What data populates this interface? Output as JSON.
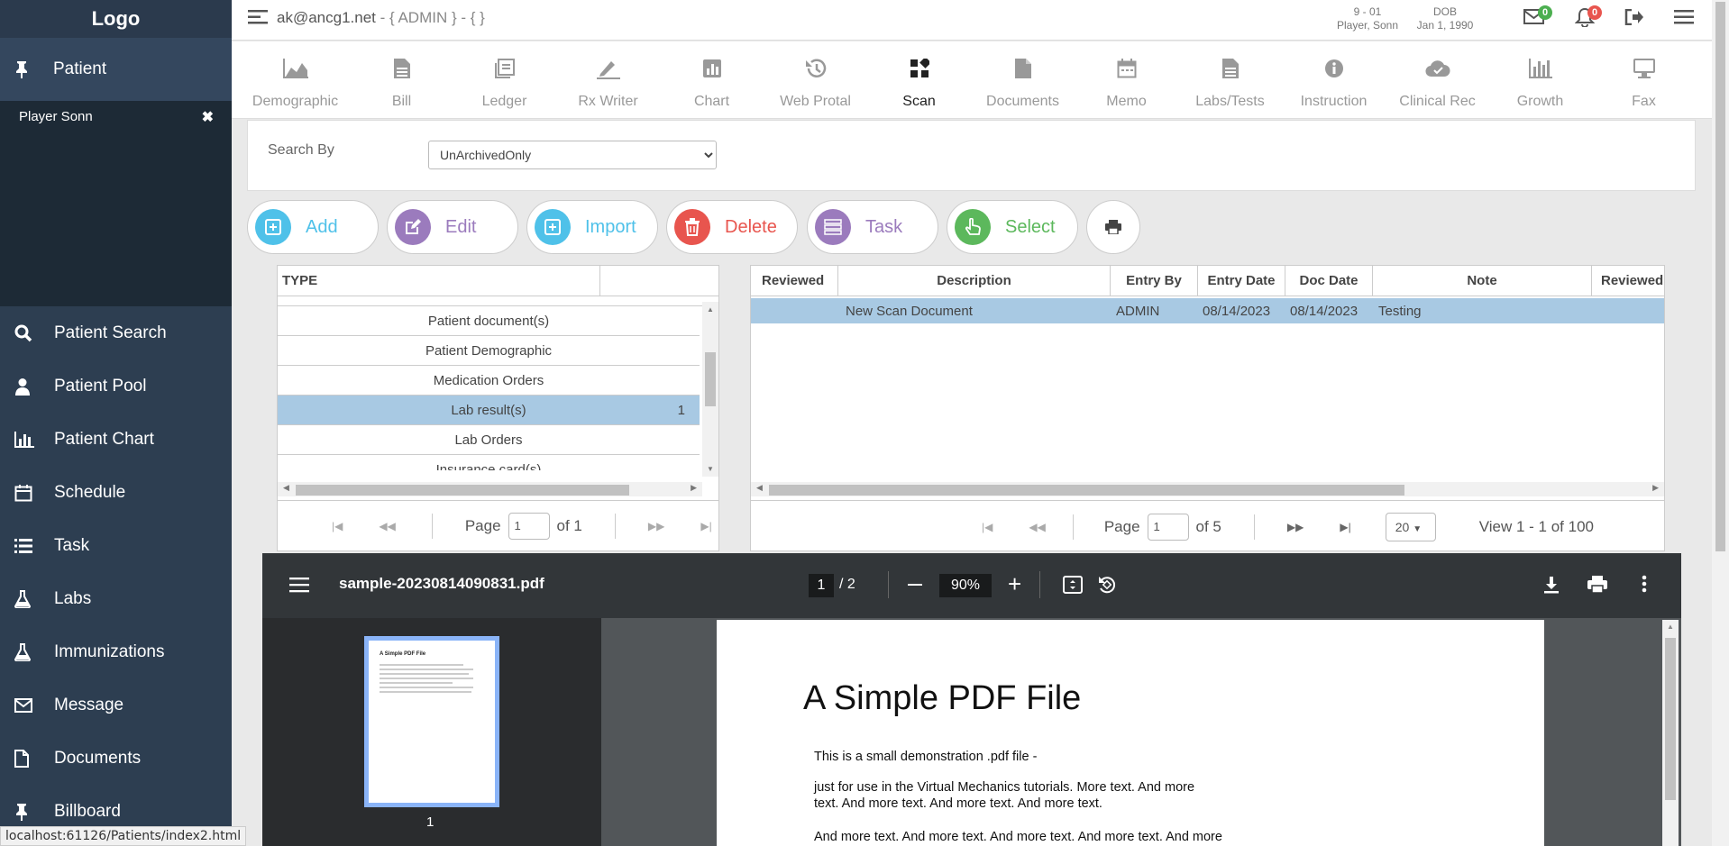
{
  "sidebar": {
    "logo": "Logo",
    "patient_label": "Patient",
    "patient_name": "Player Sonn",
    "close_glyph": "✖",
    "items": [
      {
        "label": "Patient Search",
        "icon": "search-icon"
      },
      {
        "label": "Patient Pool",
        "icon": "user-icon"
      },
      {
        "label": "Patient Chart",
        "icon": "bar-chart-icon"
      },
      {
        "label": "Schedule",
        "icon": "calendar-icon"
      },
      {
        "label": "Task",
        "icon": "list-icon"
      },
      {
        "label": "Labs",
        "icon": "flask-icon"
      },
      {
        "label": "Immunizations",
        "icon": "flask-icon"
      },
      {
        "label": "Message",
        "icon": "envelope-icon"
      },
      {
        "label": "Documents",
        "icon": "document-icon"
      },
      {
        "label": "Billboard",
        "icon": "pin-icon"
      }
    ]
  },
  "status_url": "localhost:61126/Patients/index2.html",
  "topbar": {
    "user": "ak@ancg1.net",
    "role": " - { ADMIN } - { }",
    "patient_id": "9 - 01",
    "patient_name": "Player, Sonn",
    "dob_label": "DOB",
    "dob": "Jan 1, 1990",
    "mail_count": "0",
    "notif_count": "0"
  },
  "tabs": [
    {
      "label": "Demographic",
      "icon": "area-chart-icon"
    },
    {
      "label": "Bill",
      "icon": "file-text-icon"
    },
    {
      "label": "Ledger",
      "icon": "ledger-icon"
    },
    {
      "label": "Rx Writer",
      "icon": "pen-icon"
    },
    {
      "label": "Chart",
      "icon": "chart-icon"
    },
    {
      "label": "Web Protal",
      "icon": "history-icon"
    },
    {
      "label": "Scan",
      "icon": "grid-icon",
      "active": true
    },
    {
      "label": "Documents",
      "icon": "file-icon"
    },
    {
      "label": "Memo",
      "icon": "calendar-icon"
    },
    {
      "label": "Labs/Tests",
      "icon": "file-text-icon"
    },
    {
      "label": "Instruction",
      "icon": "info-icon"
    },
    {
      "label": "Clinical Rec",
      "icon": "cloud-icon"
    },
    {
      "label": "Growth",
      "icon": "bar-chart-icon"
    },
    {
      "label": "Fax",
      "icon": "monitor-icon"
    }
  ],
  "search": {
    "label": "Search By",
    "selected": "UnArchivedOnly"
  },
  "buttons": {
    "add": "Add",
    "edit": "Edit",
    "import": "Import",
    "delete": "Delete",
    "task": "Task",
    "select": "Select"
  },
  "colors": {
    "add": "#4fc1e9",
    "edit": "#9b7bbd",
    "import": "#4fc1e9",
    "delete": "#e8554e",
    "task": "#9b7bbd",
    "select": "#5cb85c",
    "selected_row": "#a8c9e3"
  },
  "type_grid": {
    "header": "TYPE",
    "rows": [
      {
        "label": "Patient document(s)",
        "count": ""
      },
      {
        "label": "Patient Demographic",
        "count": ""
      },
      {
        "label": "Medication Orders",
        "count": ""
      },
      {
        "label": "Lab result(s)",
        "count": "1",
        "selected": true
      },
      {
        "label": "Lab Orders",
        "count": ""
      },
      {
        "label": "Insurance card(s)",
        "count": ""
      }
    ],
    "pager": {
      "page_label": "Page",
      "page": "1",
      "of": "of 1"
    }
  },
  "doc_grid": {
    "headers": [
      "Reviewed",
      "Description",
      "Entry By",
      "Entry Date",
      "Doc Date",
      "Note",
      "Reviewed"
    ],
    "rows": [
      {
        "reviewed": "",
        "description": "New Scan Document",
        "entry_by": "ADMIN",
        "entry_date": "08/14/2023",
        "doc_date": "08/14/2023",
        "note": "Testing"
      }
    ],
    "pager": {
      "page_label": "Page",
      "page": "1",
      "of": "of 5",
      "page_size": "20",
      "view": "View 1 - 1 of 100"
    }
  },
  "pdf": {
    "filename": "sample-20230814090831.pdf",
    "page": "1",
    "total": "/  2",
    "zoom": "90%",
    "thumb_label": "1",
    "thumb_title": "A Simple PDF File",
    "doc_title": "A Simple PDF File",
    "lines": [
      "This is a small demonstration .pdf file -",
      "just for use in the Virtual Mechanics tutorials. More text. And more",
      "text. And more text. And more text. And more text.",
      "And more text. And more text. And more text. And more text. And more"
    ]
  }
}
